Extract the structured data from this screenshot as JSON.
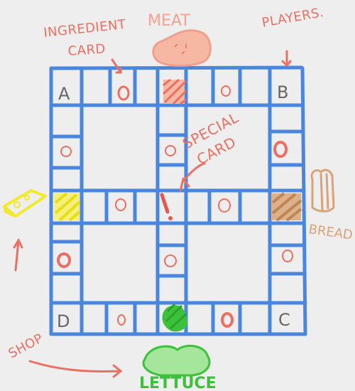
{
  "labels": {
    "ingredient_card_line1": "INGREDIENT",
    "ingredient_card_line2": "CARD",
    "meat": "MEAT",
    "players": "PLAYERS.",
    "special_line1": "SPECIAL",
    "special_line2": "CARD",
    "bread": "BREAD",
    "shop": "SHOP",
    "lettuce": "LETTUCE",
    "special_mark": "!"
  },
  "corners": {
    "top_left": "A",
    "top_right": "B",
    "bottom_right": "C",
    "bottom_left": "D"
  },
  "colors": {
    "background": "#eeeeee",
    "grid": "#4a86dd",
    "label": "#e97063",
    "meat": "#f2a08d",
    "cheese": "#f2ea2e",
    "bread": "#cf9a6d",
    "lettuce": "#3cc23a",
    "corner_text": "#666666"
  },
  "icons": [
    "ingredient-card-circle-icon",
    "meat-icon",
    "cheese-icon",
    "bread-icon",
    "lettuce-icon",
    "special-card-icon",
    "arrow-icon"
  ]
}
